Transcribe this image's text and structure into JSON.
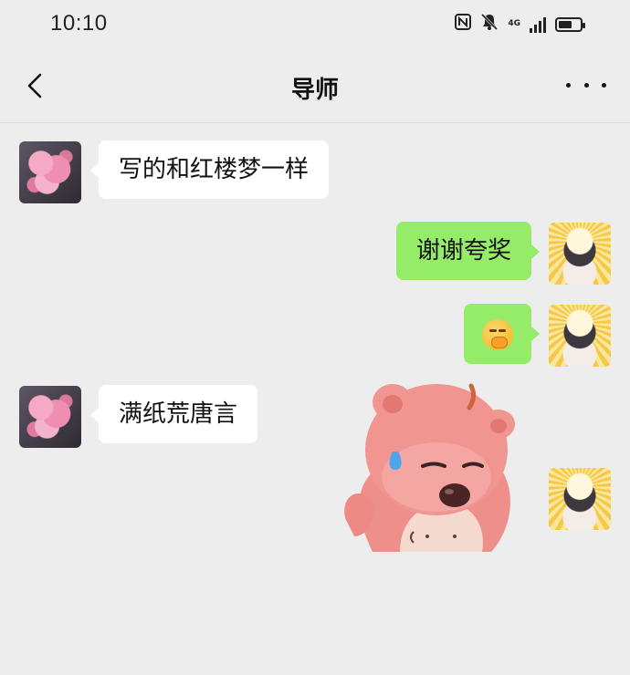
{
  "status_bar": {
    "time": "10:10",
    "network": "4G"
  },
  "nav": {
    "title": "导师"
  },
  "messages": [
    {
      "side": "in",
      "text": "写的和红楼梦一样"
    },
    {
      "side": "out",
      "text": "谢谢夸奖"
    },
    {
      "side": "out",
      "emoji": "hand-over-mouth-emoji"
    },
    {
      "side": "in",
      "text": "满纸荒唐言"
    },
    {
      "side": "out",
      "sticker": "pink-beaver-sweating-sticker"
    }
  ],
  "colors": {
    "background": "#ededed",
    "incoming_bubble": "#ffffff",
    "outgoing_bubble": "#95ec69"
  }
}
